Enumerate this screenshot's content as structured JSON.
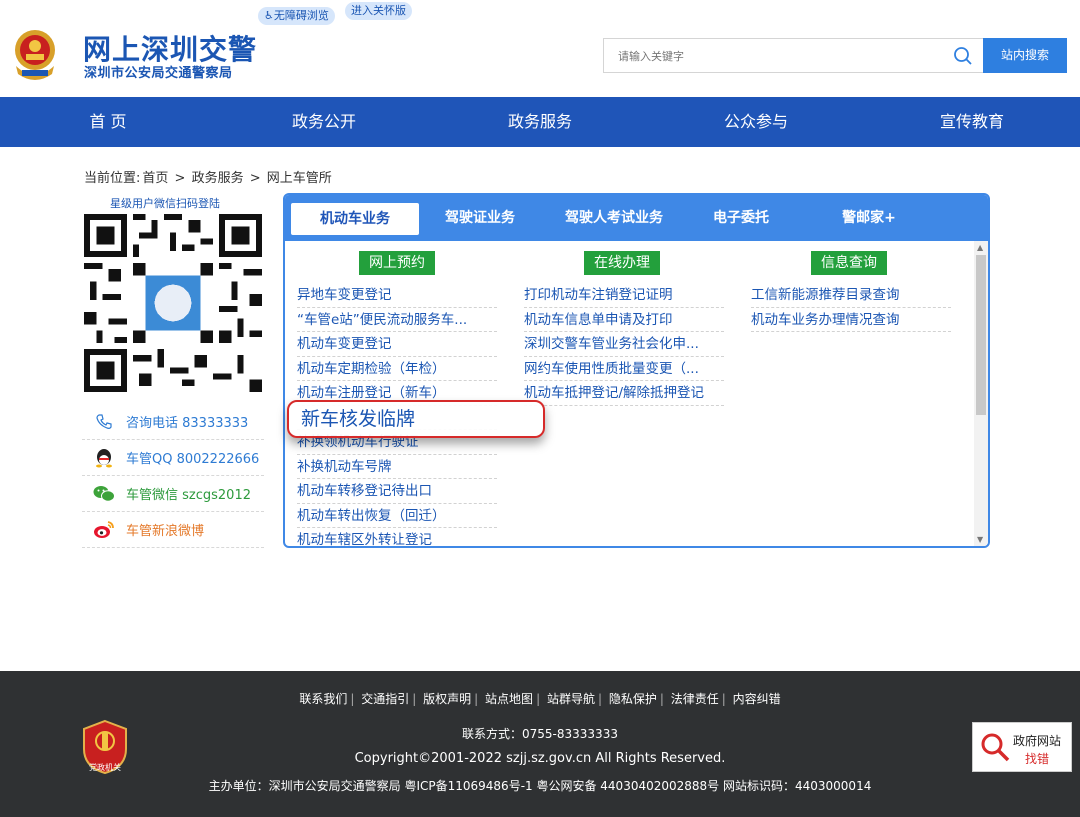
{
  "header": {
    "site_title": "网上深圳交警",
    "site_subtitle": "深圳市公安局交通警察局",
    "accessibility_label": "无障碍浏览",
    "care_mode_label": "进入关怀版",
    "search_placeholder": "请输入关键字",
    "search_button": "站内搜索"
  },
  "nav": {
    "items": [
      "首 页",
      "政务公开",
      "政务服务",
      "公众参与",
      "宣传教育"
    ]
  },
  "breadcrumb": {
    "prefix": "当前位置:",
    "items": [
      "首页",
      "政务服务",
      "网上车管所"
    ],
    "sep": ">"
  },
  "sidebar": {
    "qr_caption": "星级用户微信扫码登陆",
    "contacts": [
      {
        "label": "咨询电话 83333333",
        "icon": "phone-icon",
        "color": "#2e7bd3"
      },
      {
        "label": "车管QQ 8002222666",
        "icon": "qq-icon",
        "color": "#2e7bd3"
      },
      {
        "label": "车管微信 szcgs2012",
        "icon": "wechat-icon",
        "color": "#2d9a3c"
      },
      {
        "label": "车管新浪微博",
        "icon": "weibo-icon",
        "color": "#e4792a"
      }
    ]
  },
  "panel": {
    "tabs": [
      "机动车业务",
      "驾驶证业务",
      "驾驶人考试业务",
      "电子委托",
      "警邮家+"
    ],
    "active_tab": "机动车业务",
    "columns": [
      {
        "heading": "网上预约",
        "items": [
          "异地车变更登记",
          "“车管e站”便民流动服务车...",
          "机动车变更登记",
          "机动车定期检验（年检）",
          "机动车注册登记（新车）",
          "",
          "补换领机动车行驶证",
          "补换机动车号牌",
          "机动车转移登记待出口",
          "机动车转出恢复（回迁）",
          "机动车辖区外转让登记"
        ]
      },
      {
        "heading": "在线办理",
        "items": [
          "打印机动车注销登记证明",
          "机动车信息单申请及打印",
          "深圳交警车管业务社会化申...",
          "网约车使用性质批量变更（...",
          "机动车抵押登记/解除抵押登记"
        ]
      },
      {
        "heading": "信息查询",
        "items": [
          "工信新能源推荐目录查询",
          "机动车业务办理情况查询"
        ]
      }
    ],
    "callout": "新车核发临牌"
  },
  "footer": {
    "links": [
      "联系我们",
      "交通指引",
      "版权声明",
      "站点地图",
      "站群导航",
      "隐私保护",
      "法律责任",
      "内容纠错"
    ],
    "contact": "联系方式：0755-83333333",
    "copyright": "Copyright©2001-2022 szjj.sz.gov.cn   All Rights Reserved.",
    "host": "主办单位：深圳市公安局交通警察局  粤ICP备11069486号-1  粤公网安备 44030402002888号  网站标识码：4403000014",
    "gov_badge": "党政机关",
    "find_error_line1": "政府网站",
    "find_error_line2": "找错"
  },
  "colors": {
    "brand_blue": "#1b56b3",
    "nav_blue": "#1f55b8",
    "tab_blue": "#3f88e6",
    "green": "#23a03c",
    "callout_red": "#d62a2a"
  }
}
